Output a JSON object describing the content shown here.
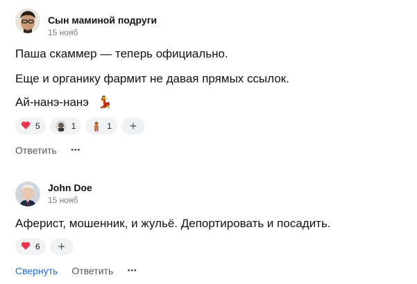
{
  "comments": [
    {
      "author": "Сын маминой подруги",
      "date": "15 нояб",
      "lines": [
        "Паша скаммер — теперь официально.",
        "Еще и органику фармит не давая прямых ссылок.",
        "Ай-нанэ-нанэ"
      ],
      "emoji": "💃",
      "reactions": [
        {
          "icon": "heart-icon",
          "count": "5"
        },
        {
          "icon": "avatar-reaction",
          "count": "1"
        },
        {
          "icon": "avatar-reaction",
          "count": "1"
        }
      ],
      "add_label": "+",
      "actions": {
        "reply": "Ответить",
        "more": "⋯"
      }
    },
    {
      "author": "John Doe",
      "date": "15 нояб",
      "lines": [
        "Аферист, мошенник, и жульё. Депортировать и посадить."
      ],
      "reactions": [
        {
          "icon": "heart-icon",
          "count": "6"
        }
      ],
      "add_label": "+",
      "actions": {
        "collapse": "Свернуть",
        "reply": "Ответить",
        "more": "⋯"
      }
    }
  ],
  "colors": {
    "link": "#1f6bd6",
    "heart": "#e8364f",
    "chip": "#f1f2f4"
  }
}
